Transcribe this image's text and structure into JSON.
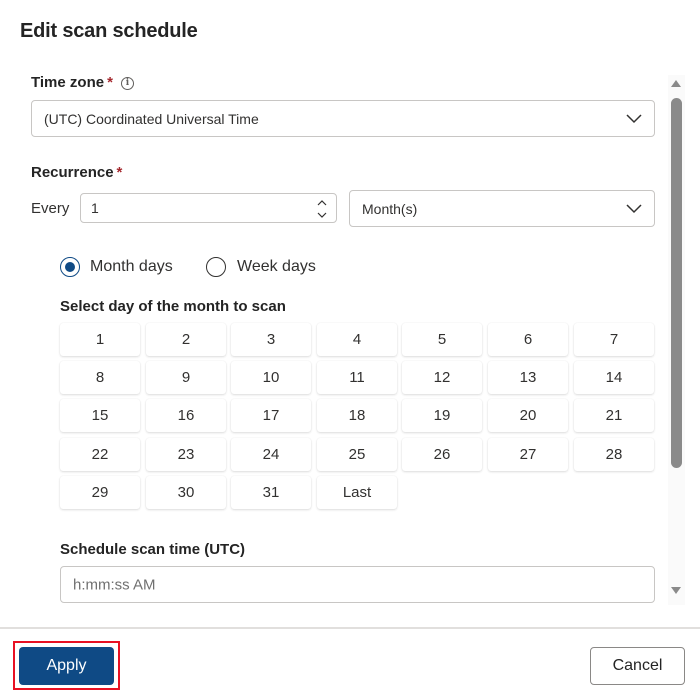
{
  "dialog": {
    "title": "Edit scan schedule"
  },
  "time_zone": {
    "label": "Time zone",
    "required_mark": "*",
    "info_icon": "info-icon",
    "value": "(UTC) Coordinated Universal Time"
  },
  "recurrence": {
    "label": "Recurrence",
    "required_mark": "*",
    "every_label": "Every",
    "interval_value": "1",
    "unit_value": "Month(s)"
  },
  "day_mode": {
    "options": [
      {
        "label": "Month days",
        "checked": true
      },
      {
        "label": "Week days",
        "checked": false
      }
    ]
  },
  "month_days": {
    "label": "Select day of the month to scan",
    "days": [
      "1",
      "2",
      "3",
      "4",
      "5",
      "6",
      "7",
      "8",
      "9",
      "10",
      "11",
      "12",
      "13",
      "14",
      "15",
      "16",
      "17",
      "18",
      "19",
      "20",
      "21",
      "22",
      "23",
      "24",
      "25",
      "26",
      "27",
      "28",
      "29",
      "30",
      "31",
      "Last"
    ]
  },
  "scan_time": {
    "label": "Schedule scan time (UTC)",
    "placeholder": "h:mm:ss AM",
    "value": ""
  },
  "footer": {
    "apply_label": "Apply",
    "cancel_label": "Cancel"
  },
  "colors": {
    "primary": "#0f4a85",
    "required": "#a4262c",
    "highlight": "#e81123"
  }
}
